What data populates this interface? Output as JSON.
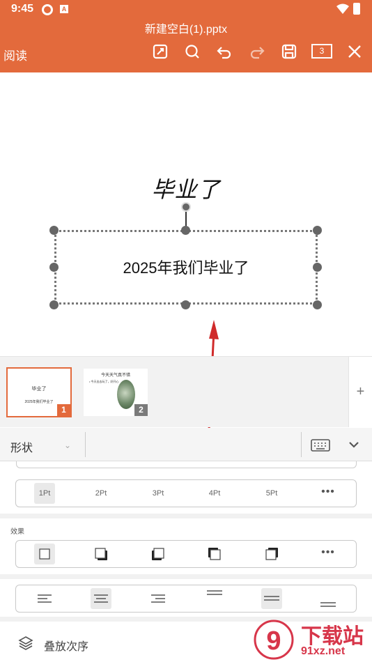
{
  "status": {
    "time": "9:45",
    "notification_icons": [
      "sync-icon",
      "app-a-icon"
    ],
    "right_icons": [
      "wifi-icon",
      "battery-icon"
    ]
  },
  "header": {
    "file_name": "新建空白(1).pptx",
    "read_mode_label": "阅读",
    "page_count": "3",
    "toolbar_icons": [
      "edit-icon",
      "search-icon",
      "undo-icon",
      "redo-icon",
      "save-icon",
      "page-count-icon",
      "close-icon"
    ],
    "accent_color": "#E36A3C"
  },
  "slide": {
    "title": "毕业了",
    "selected_text": "2025年我们毕业了"
  },
  "thumbnails": [
    {
      "number": "1",
      "title": "毕业了",
      "subtitle": "2025年我们毕业了",
      "selected": true
    },
    {
      "number": "2",
      "title": "今天天气真不错",
      "bullet": "• 今天出去玩了，好开心",
      "selected": false
    }
  ],
  "add_slide_label": "+",
  "panel": {
    "title": "形状",
    "line_widths": [
      "1Pt",
      "2Pt",
      "3Pt",
      "4Pt",
      "5Pt"
    ],
    "selected_line_width": "1Pt",
    "more_label": "•••",
    "effect_label": "效果",
    "effects": [
      "no-shadow-icon",
      "shadow-bottom-right-icon",
      "shadow-bottom-left-icon",
      "shadow-top-left-icon",
      "shadow-top-right-icon"
    ],
    "alignments": [
      "align-left-icon",
      "align-center-icon",
      "align-right-icon",
      "align-top-icon",
      "align-middle-icon",
      "align-bottom-icon"
    ],
    "order_label": "叠放次序"
  },
  "watermark": {
    "main": "下载站",
    "sub": "91xz.net",
    "logo_text": "9"
  }
}
